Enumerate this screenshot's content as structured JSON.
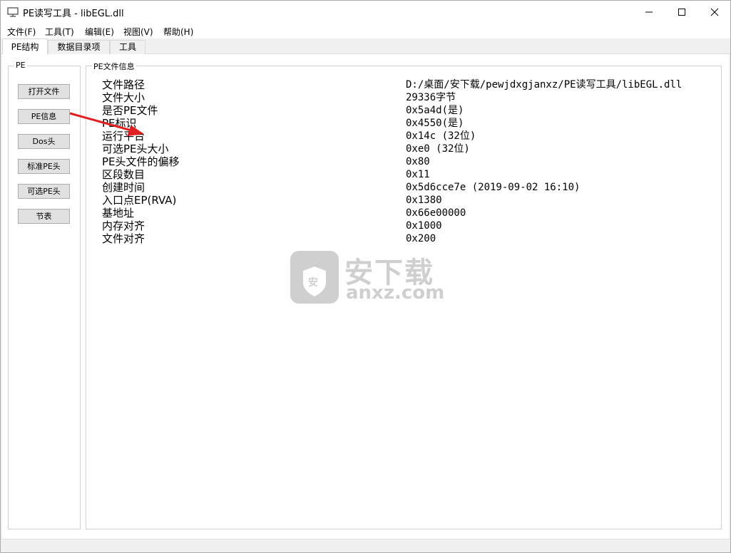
{
  "window": {
    "title": "PE读写工具 - libEGL.dll"
  },
  "menu": [
    "文件(F)",
    "工具(T)",
    "编辑(E)",
    "视图(V)",
    "帮助(H)"
  ],
  "tabs": [
    "PE结构",
    "数据目录项",
    "工具"
  ],
  "left_group": {
    "title": "PE",
    "buttons": [
      "打开文件",
      "PE信息",
      "Dos头",
      "标准PE头",
      "可选PE头",
      "节表"
    ]
  },
  "info_group": {
    "title": "PE文件信息",
    "rows": [
      {
        "label": "文件路径",
        "value": "D:/桌面/安下载/pewjdxgjanxz/PE读写工具/libEGL.dll"
      },
      {
        "label": "文件大小",
        "value": "29336字节"
      },
      {
        "label": "是否PE文件",
        "value": "0x5a4d(是)"
      },
      {
        "label": "PE标识",
        "value": "0x4550(是)"
      },
      {
        "label": "运行平台",
        "value": "0x14c (32位)"
      },
      {
        "label": "可选PE头大小",
        "value": "0xe0 (32位)"
      },
      {
        "label": "PE头文件的偏移",
        "value": "0x80"
      },
      {
        "label": "区段数目",
        "value": "0x11"
      },
      {
        "label": "创建时间",
        "value": "0x5d6cce7e (2019-09-02 16:10)"
      },
      {
        "label": "入口点EP(RVA)",
        "value": "0x1380"
      },
      {
        "label": "基地址",
        "value": "0x66e00000"
      },
      {
        "label": "内存对齐",
        "value": "0x1000"
      },
      {
        "label": "文件对齐",
        "value": "0x200"
      }
    ]
  },
  "watermark": {
    "brand": "安下载",
    "domain": "anxz.com",
    "badge": "安"
  },
  "colors": {
    "arrow": "#e02020",
    "watermark": "#a8a8a8"
  }
}
